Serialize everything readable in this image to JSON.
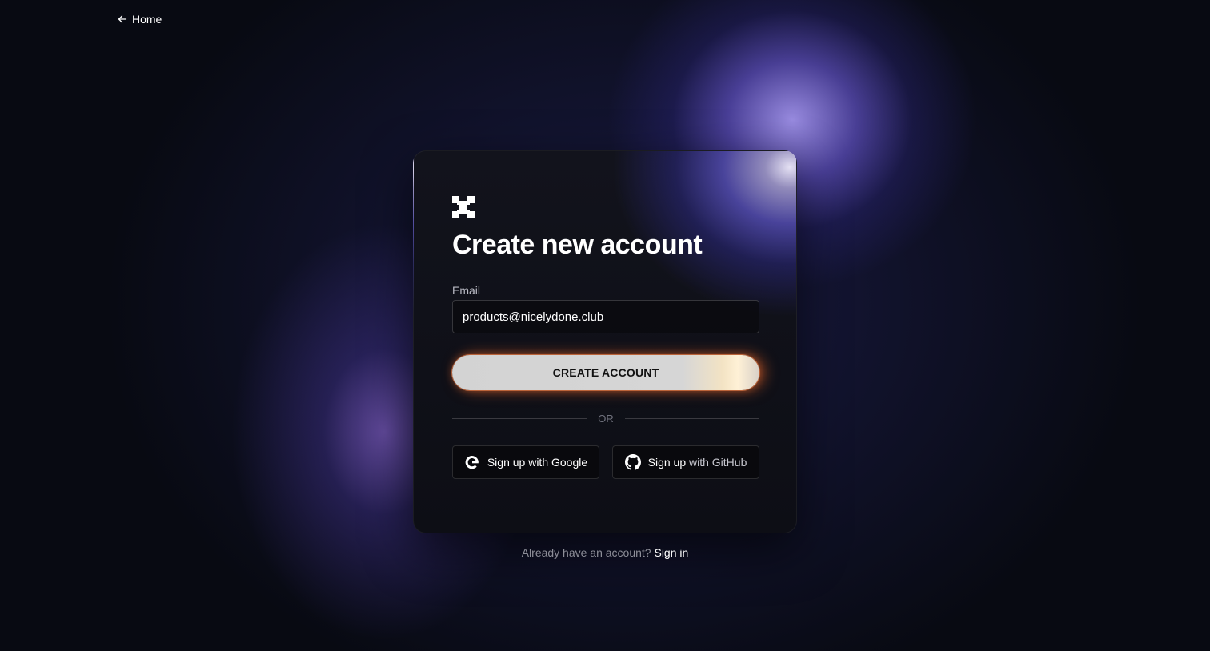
{
  "nav": {
    "home_label": "Home"
  },
  "card": {
    "title": "Create new account",
    "email_label": "Email",
    "email_value": "products@nicelydone.club",
    "create_button_label": "CREATE ACCOUNT",
    "divider_label": "OR",
    "google_button_label": "Sign up with Google",
    "github_button_label_prefix": "Sign up",
    "github_button_label_suffix": "with GitHub"
  },
  "footer": {
    "prompt": "Already have an account?",
    "signin_label": "Sign in"
  },
  "icons": {
    "back": "arrow-left-icon",
    "logo": "brand-logo",
    "google": "google-icon",
    "github": "github-icon"
  },
  "colors": {
    "background": "#080a12",
    "accent_glow": "#8a7cff",
    "button_bg": "#d3d3d3",
    "button_glow": "#ff7a3a"
  }
}
